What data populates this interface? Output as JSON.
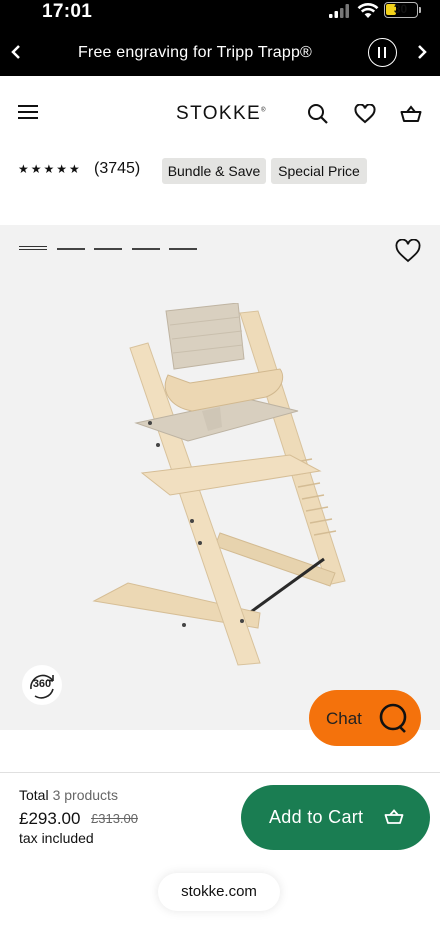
{
  "status_bar": {
    "time": "17:01",
    "battery": "30",
    "battery_color": "#f2d21b"
  },
  "promo": {
    "text": "Free engraving for Tripp Trapp®"
  },
  "header": {
    "logo": "STOKKE"
  },
  "rating": {
    "stars": "★★★★★",
    "value": 5,
    "count": "(3745)"
  },
  "badges": [
    "Bundle & Save",
    "Special Price"
  ],
  "gallery": {
    "slides": 5,
    "active_slide": 1,
    "view360": "360"
  },
  "chat": {
    "label": "Chat",
    "color": "#f4720c"
  },
  "cart": {
    "total_label": "Total",
    "products": "3 products",
    "price": "£293.00",
    "old_price": "£313.00",
    "tax": "tax included",
    "button": "Add to Cart",
    "button_color": "#1a7d52"
  },
  "browser": {
    "url": "stokke.com"
  }
}
